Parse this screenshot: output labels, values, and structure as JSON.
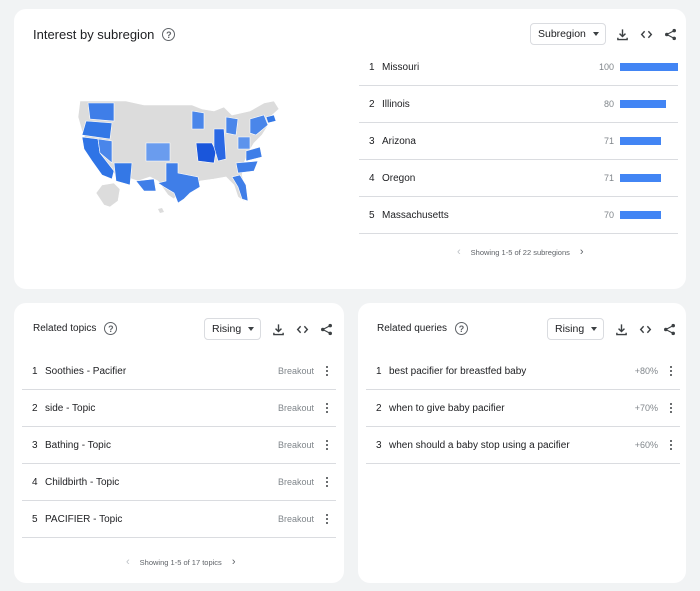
{
  "subregion": {
    "title": "Interest by subregion",
    "select_label": "Subregion",
    "rows": [
      {
        "rank": "1",
        "name": "Missouri",
        "value": "100",
        "fill": 1.0
      },
      {
        "rank": "2",
        "name": "Illinois",
        "value": "80",
        "fill": 0.8
      },
      {
        "rank": "3",
        "name": "Arizona",
        "value": "71",
        "fill": 0.71
      },
      {
        "rank": "4",
        "name": "Oregon",
        "value": "71",
        "fill": 0.71
      },
      {
        "rank": "5",
        "name": "Massachusetts",
        "value": "70",
        "fill": 0.7
      }
    ],
    "pager_text": "Showing 1-5 of 22 subregions"
  },
  "topics": {
    "title": "Related topics",
    "select_label": "Rising",
    "rows": [
      {
        "rank": "1",
        "name": "Soothies - Pacifier",
        "value": "Breakout"
      },
      {
        "rank": "2",
        "name": "side - Topic",
        "value": "Breakout"
      },
      {
        "rank": "3",
        "name": "Bathing - Topic",
        "value": "Breakout"
      },
      {
        "rank": "4",
        "name": "Childbirth - Topic",
        "value": "Breakout"
      },
      {
        "rank": "5",
        "name": "PACIFIER - Topic",
        "value": "Breakout"
      }
    ],
    "pager_text": "Showing 1-5 of 17 topics"
  },
  "queries": {
    "title": "Related queries",
    "select_label": "Rising",
    "rows": [
      {
        "rank": "1",
        "name": "best pacifier for breastfed baby",
        "value": "+80%"
      },
      {
        "rank": "2",
        "name": "when to give baby pacifier",
        "value": "+70%"
      },
      {
        "rank": "3",
        "name": "when should a baby stop using a pacifier",
        "value": "+60%"
      }
    ]
  },
  "colors": {
    "accent": "#4285f4",
    "map_base": "#dcdcdc",
    "map_high": "#1a56db"
  },
  "icons": [
    "help-icon",
    "download-icon",
    "embed-icon",
    "share-icon",
    "more-vert-icon",
    "chevron-left-icon",
    "chevron-right-icon",
    "dropdown-caret-icon"
  ]
}
